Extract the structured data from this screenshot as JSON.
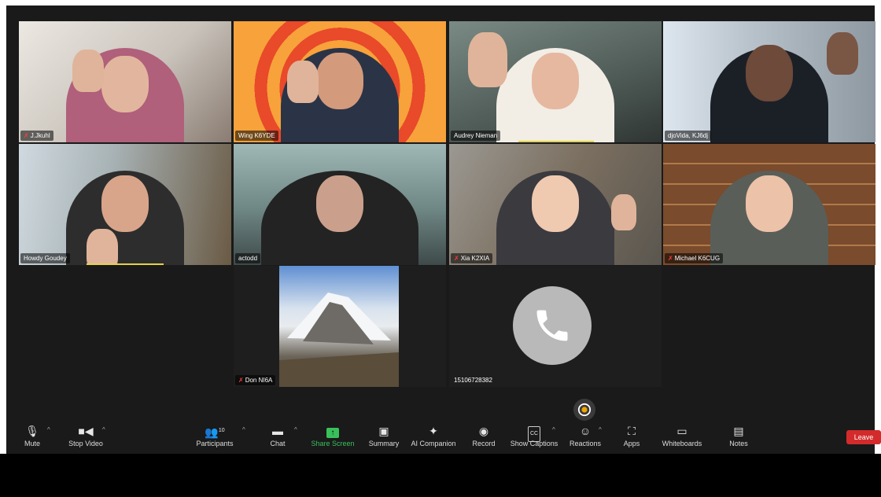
{
  "participants": [
    {
      "name": "J.Jkuhl",
      "muted": true
    },
    {
      "name": "Wing K6YDE",
      "muted": false
    },
    {
      "name": "Audrey Nieman",
      "muted": false
    },
    {
      "name": "djoVida, KJ6dj",
      "muted": false,
      "active_speaker": true
    },
    {
      "name": "Howdy Goudey",
      "muted": false
    },
    {
      "name": "actodd",
      "muted": false
    },
    {
      "name": "Xia   K2XIA",
      "muted": true
    },
    {
      "name": "Michael K6CUG",
      "muted": true
    },
    {
      "name": "Don NI6A",
      "muted": true
    },
    {
      "name": "15106728382",
      "muted": false
    }
  ],
  "toolbar": {
    "mute": "Mute",
    "stop_video": "Stop Video",
    "participants": "Participants",
    "participant_count": "10",
    "chat": "Chat",
    "share_screen": "Share Screen",
    "summary": "Summary",
    "ai_companion": "AI Companion",
    "record": "Record",
    "show_captions": "Show Captions",
    "cc_badge": "CC",
    "reactions": "Reactions",
    "apps": "Apps",
    "whiteboards": "Whiteboards",
    "notes": "Notes",
    "leave": "Leave"
  },
  "icons": {
    "mute": "microphone-icon",
    "video": "video-camera-icon",
    "participants": "people-icon",
    "chat": "chat-bubble-icon",
    "share": "share-screen-icon",
    "summary": "document-sparkle-icon",
    "ai": "sparkle-icon",
    "record": "record-icon",
    "reactions": "emoji-icon",
    "apps": "apps-icon",
    "whiteboards": "whiteboard-icon",
    "notes": "notes-icon",
    "phone": "phone-icon"
  },
  "colors": {
    "accent_green": "#39c05b",
    "leave_red": "#d32b2b",
    "speaker_outline": "#cfe65a"
  }
}
